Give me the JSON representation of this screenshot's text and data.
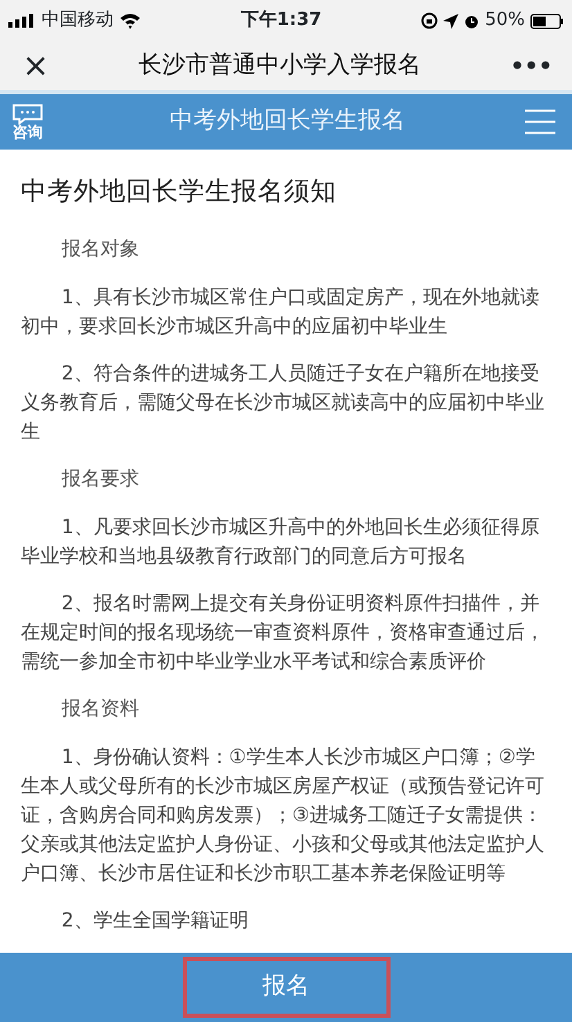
{
  "status_bar": {
    "carrier": "中国移动",
    "time": "下午1:37",
    "battery": "50%"
  },
  "nav_bar": {
    "close": "×",
    "title": "长沙市普通中小学入学报名",
    "more": "•••"
  },
  "header": {
    "consult_label": "咨询",
    "title": "中考外地回长学生报名"
  },
  "notice": {
    "title": "中考外地回长学生报名须知",
    "paragraphs": [
      {
        "kind": "heading",
        "text": "报名对象"
      },
      {
        "kind": "item",
        "text": "1、具有长沙市城区常住户口或固定房产，现在外地就读初中，要求回长沙市城区升高中的应届初中毕业生"
      },
      {
        "kind": "item",
        "text": "2、符合条件的进城务工人员随迁子女在户籍所在地接受义务教育后，需随父母在长沙市城区就读高中的应届初中毕业生"
      },
      {
        "kind": "heading",
        "text": "报名要求"
      },
      {
        "kind": "item",
        "text": "1、凡要求回长沙市城区升高中的外地回长生必须征得原毕业学校和当地县级教育行政部门的同意后方可报名"
      },
      {
        "kind": "item",
        "text": "2、报名时需网上提交有关身份证明资料原件扫描件，并在规定时间的报名现场统一审查资料原件，资格审查通过后，需统一参加全市初中毕业学业水平考试和综合素质评价"
      },
      {
        "kind": "heading",
        "text": "报名资料"
      },
      {
        "kind": "item",
        "text": "1、身份确认资料：①学生本人长沙市城区户口簿；②学生本人或父母所有的长沙市城区房屋产权证（或预告登记许可证，含购房合同和购房发票）；③进城务工随迁子女需提供：父亲或其他法定监护人身份证、小孩和父母或其他法定监护人户口簿、长沙市居住证和长沙市职工基本养老保险证明等"
      },
      {
        "kind": "item",
        "text": "2、学生全国学籍证明"
      }
    ]
  },
  "submit_button": {
    "label": "报名"
  }
}
